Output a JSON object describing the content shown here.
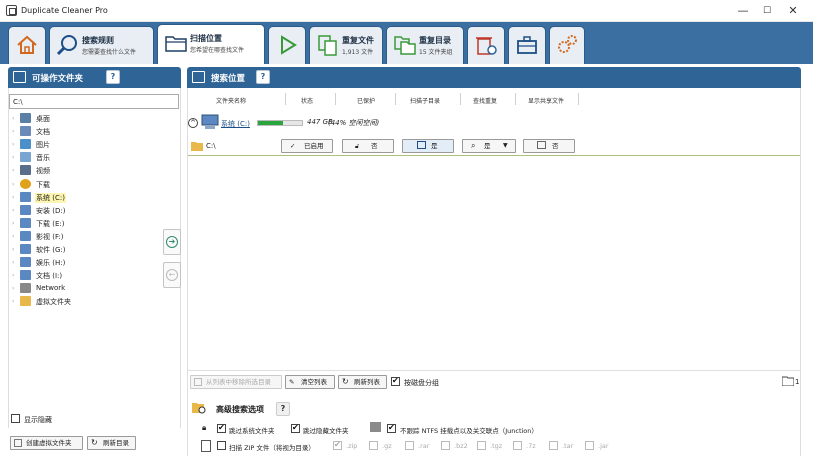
{
  "window": {
    "title": "Duplicate Cleaner Pro",
    "minimize": "—",
    "maximize": "☐",
    "close": "✕"
  },
  "tabs": [
    {
      "name": "home",
      "icon": "home-icon",
      "title": "",
      "sub": ""
    },
    {
      "name": "search-criteria",
      "icon": "magnifier-icon",
      "title": "搜索规则",
      "sub": "您需要查找什么文件"
    },
    {
      "name": "scan-location",
      "icon": "folder-icon",
      "title": "扫描位置",
      "sub": "您希望在哪查找文件"
    },
    {
      "name": "start-scan",
      "icon": "play-icon",
      "title": "",
      "sub": ""
    },
    {
      "name": "duplicate-files",
      "icon": "duplicate-files-icon",
      "title": "重复文件",
      "sub": "1,913 文件"
    },
    {
      "name": "duplicate-folders",
      "icon": "duplicate-folders-icon",
      "title": "重复目录",
      "sub": "15 文件夹组"
    },
    {
      "name": "removal",
      "icon": "trash-icon",
      "title": "",
      "sub": ""
    },
    {
      "name": "toolbox",
      "icon": "toolbox-icon",
      "title": "",
      "sub": ""
    },
    {
      "name": "settings",
      "icon": "gears-icon",
      "title": "",
      "sub": ""
    }
  ],
  "left_panel": {
    "title": "可操作文件夹",
    "help": "?",
    "path": "C:\\",
    "tree": [
      {
        "label": "桌面",
        "icon": "desktop-icon",
        "color": "#5b7fa5"
      },
      {
        "label": "文档",
        "icon": "documents-icon",
        "color": "#6a8bb8"
      },
      {
        "label": "图片",
        "icon": "pictures-icon",
        "color": "#4d8fc9"
      },
      {
        "label": "音乐",
        "icon": "music-icon",
        "color": "#7aa4d1"
      },
      {
        "label": "视频",
        "icon": "videos-icon",
        "color": "#5a6e8c"
      },
      {
        "label": "下载",
        "icon": "download-icon",
        "color": "#e0a21a"
      },
      {
        "label": "系统 (C:)",
        "icon": "drive-icon",
        "color": "#5b88c0"
      },
      {
        "label": "安装 (D:)",
        "icon": "drive-icon",
        "color": "#5b88c0"
      },
      {
        "label": "下载 (E:)",
        "icon": "drive-icon",
        "color": "#5b88c0"
      },
      {
        "label": "影视 (F:)",
        "icon": "drive-icon",
        "color": "#5b88c0"
      },
      {
        "label": "软件 (G:)",
        "icon": "drive-icon",
        "color": "#5b88c0"
      },
      {
        "label": "娱乐 (H:)",
        "icon": "drive-icon",
        "color": "#5b88c0"
      },
      {
        "label": "文档 (I:)",
        "icon": "drive-icon",
        "color": "#5b88c0"
      },
      {
        "label": "Network",
        "icon": "network-icon",
        "color": "#888888"
      },
      {
        "label": "虚拟文件夹",
        "icon": "virtual-folder-icon",
        "color": "#e8b84a"
      }
    ],
    "selected_index": 6,
    "show_hidden_label": "显示隐藏",
    "create_virtual_label": "创建虚拟文件夹",
    "refresh_label": "刷新目录"
  },
  "main_panel": {
    "title": "搜索位置",
    "help": "?",
    "columns": [
      "文件夹名称",
      "状态",
      "已保护",
      "扫描子目录",
      "查找重复",
      "显示共享文件"
    ],
    "drive": {
      "name": "系统 (C:)",
      "size": "447 GB",
      "free": "(44% 空闲空间)",
      "used_fraction": 0.56
    },
    "row": {
      "path": "C:\\",
      "status": "已启用",
      "protected": "否",
      "subdirs": "是",
      "find_dups": "是",
      "shared": "否"
    },
    "remove_label": "从列表中移除所选目录",
    "clear_label": "清空列表",
    "refresh_label": "刷新列表",
    "group_label": "按磁盘分组",
    "folder_count": "1"
  },
  "advanced": {
    "title": "高级搜索选项",
    "help": "?",
    "skip_system": "跳过系统文件夹",
    "skip_hidden": "跳过隐藏文件夹",
    "skip_ntfs": "不跟踪 NTFS 挂载点以及关交联点（Junction）",
    "scan_zip": "扫描 ZIP 文件（将视为目录）",
    "archive_types": [
      ".zip",
      ".gz",
      ".rar",
      ".bz2",
      ".tgz",
      ".7z",
      ".tar",
      ".jar"
    ]
  },
  "colors": {
    "tabbar": "#3b6ea1",
    "panel_header": "#2f6496",
    "progress": "#2aa43c",
    "selected_item": "#fdf6b0"
  }
}
